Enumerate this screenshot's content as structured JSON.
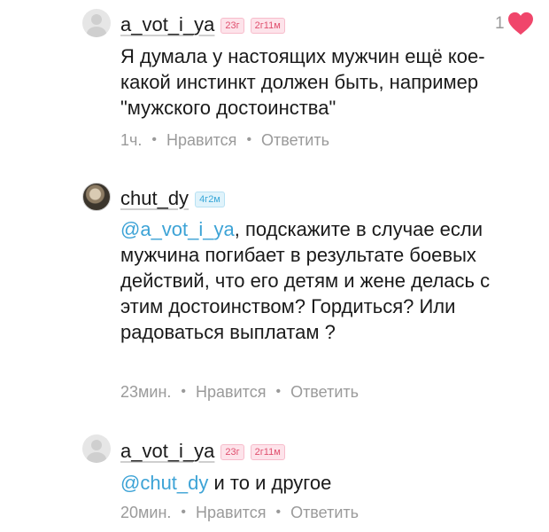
{
  "comments": [
    {
      "username": "a_vot_i_ya",
      "badges": [
        "23г",
        "2г11м"
      ],
      "text": "Я думала у настоящих мужчин ещё кое-какой инстинкт должен быть, например \"мужского достоинства\"",
      "time": "1ч.",
      "like_label": "Нравится",
      "reply_label": "Ответить",
      "likes": "1"
    },
    {
      "username": "chut_dy",
      "badges": [
        "4г2м"
      ],
      "mention": "@a_vot_i_ya",
      "text": ", подскажите в случае если мужчина погибает в результате боевых действий, что его детям и жене делась с этим достоинством? Гордиться? Или радоваться выплатам ?",
      "time": "23мин.",
      "like_label": "Нравится",
      "reply_label": "Ответить"
    },
    {
      "username": "a_vot_i_ya",
      "badges": [
        "23г",
        "2г11м"
      ],
      "mention": "@chut_dy",
      "text": " и то и другое",
      "time": "20мин.",
      "like_label": "Нравится",
      "reply_label": "Ответить"
    }
  ],
  "icons": {
    "heart": "heart-icon",
    "avatar_default": "default-avatar-icon"
  },
  "colors": {
    "mention": "#3da3d6",
    "heart": "#f0466b",
    "muted": "#9a9a9a"
  }
}
